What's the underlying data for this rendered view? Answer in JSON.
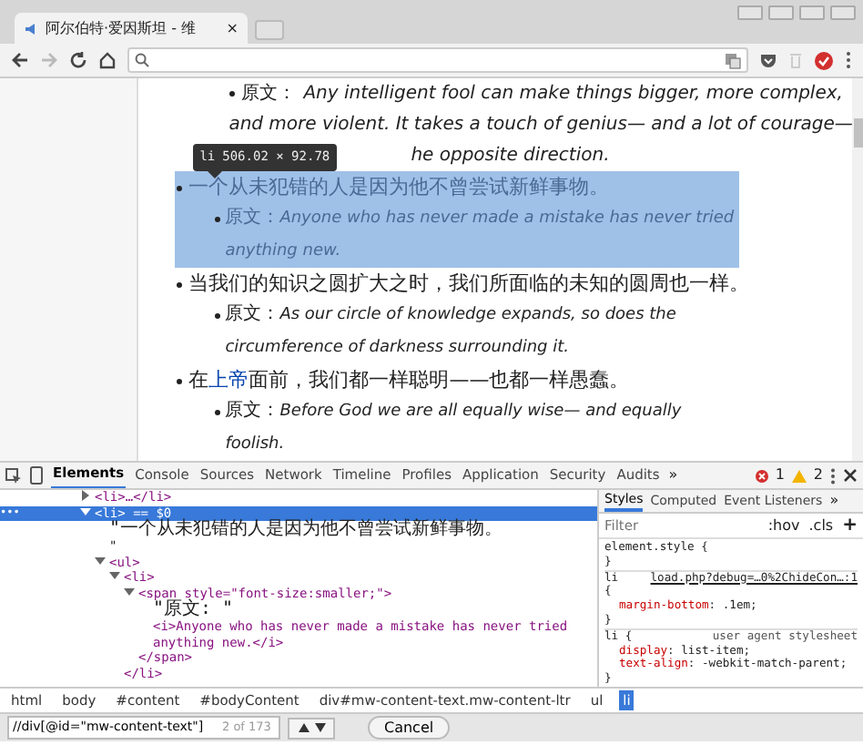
{
  "browser": {
    "tab_title": "阿尔伯特·爱因斯坦 - 维",
    "tab_close": "×"
  },
  "article": {
    "fragment": {
      "label": "原文：",
      "lines": [
        "Any intelligent fool can make things bigger, more complex,",
        "and more violent. It takes a touch of genius— and a lot of courage—",
        "he opposite direction."
      ]
    },
    "tooltip": {
      "tag": "li",
      "size": "506.02 × 92.78"
    },
    "items": [
      {
        "highlighted": true,
        "parts": [
          {
            "text": "一个从未犯错的人是因为他不曾尝试新鲜事物。",
            "link": false
          }
        ],
        "label": "原文：",
        "quote": "Anyone who has never made a mistake has never tried anything new."
      },
      {
        "highlighted": false,
        "parts": [
          {
            "text": "当我们的知识之圆扩大之时，我们所面临的未知的圆周也一样。",
            "link": false
          }
        ],
        "label": "原文：",
        "quote": "As our circle of knowledge expands, so does the circumference of darkness surrounding it."
      },
      {
        "highlighted": false,
        "parts": [
          {
            "text": "在",
            "link": false
          },
          {
            "text": "上帝",
            "link": true
          },
          {
            "text": "面前，我们都一样聪明——也都一样愚蠢。",
            "link": false
          }
        ],
        "label": "原文：",
        "quote": "Before God we are all equally wise— and equally foolish."
      }
    ]
  },
  "devtools": {
    "tabs": [
      {
        "label": "Elements",
        "selected": true
      },
      {
        "label": "Console",
        "selected": false
      },
      {
        "label": "Sources",
        "selected": false
      },
      {
        "label": "Network",
        "selected": false
      },
      {
        "label": "Timeline",
        "selected": false
      },
      {
        "label": "Profiles",
        "selected": false
      },
      {
        "label": "Application",
        "selected": false
      },
      {
        "label": "Security",
        "selected": false
      },
      {
        "label": "Audits",
        "selected": false
      }
    ],
    "more": "»",
    "errors": "1",
    "warnings": "2",
    "dom": [
      {
        "text": "<li>…</li>",
        "kind": "tag",
        "expanded": false,
        "selected": false
      },
      {
        "text": "<li> == $0",
        "kind": "tag",
        "expanded": true,
        "selected": true,
        "gutter": "•••",
        "children": [
          {
            "text": "\"一个从未犯错的人是因为他不曾尝试新鲜事物。",
            "kind": "text"
          },
          {
            "text": "\"",
            "kind": "text"
          },
          {
            "text": "<ul>",
            "kind": "tag",
            "expanded": true,
            "children": [
              {
                "text": "<li>",
                "kind": "tag",
                "expanded": true,
                "children": [
                  {
                    "text": "<span style=\"font-size:smaller;\">",
                    "kind": "tag",
                    "expanded": true,
                    "children": [
                      {
                        "text": "\"原文: \"",
                        "kind": "text"
                      },
                      {
                        "text": "<i>Anyone who has never made a mistake has never tried anything new.</i>",
                        "kind": "tag"
                      }
                    ],
                    "closing": "</span>"
                  }
                ],
                "closing": "</li>"
              }
            ]
          }
        ]
      }
    ],
    "breadcrumbs": [
      {
        "label": "html",
        "selected": false
      },
      {
        "label": "body",
        "selected": false
      },
      {
        "label": "#content",
        "selected": false
      },
      {
        "label": "#bodyContent",
        "selected": false
      },
      {
        "label": "div#mw-content-text.mw-content-ltr",
        "selected": false
      },
      {
        "label": "ul",
        "selected": false
      },
      {
        "label": "li",
        "selected": true
      }
    ],
    "search": {
      "value": "//div[@id=\"mw-content-text\"]",
      "count": "2 of 173",
      "cancel": "Cancel"
    },
    "styles": {
      "tabs": [
        {
          "label": "Styles",
          "selected": true
        },
        {
          "label": "Computed",
          "selected": false
        },
        {
          "label": "Event Listeners",
          "selected": false
        }
      ],
      "more": "»",
      "filter_placeholder": "Filter",
      "hov": ":hov",
      "cls": ".cls",
      "add": "+",
      "rules": [
        {
          "selector": "element.style {",
          "close": "}"
        },
        {
          "selector": "li",
          "source": "load.php?debug=…0%2ChideCon…:1",
          "open": "{",
          "declarations": [
            {
              "prop": "margin-bottom",
              "value": ": .1em;"
            }
          ],
          "close": "}"
        },
        {
          "selector": "li {",
          "source": "user agent stylesheet",
          "declarations": [
            {
              "prop": "display",
              "value": ": list-item;"
            },
            {
              "prop": "text-align",
              "value": ": -webkit-match-parent;"
            }
          ],
          "close": "}"
        }
      ]
    }
  }
}
